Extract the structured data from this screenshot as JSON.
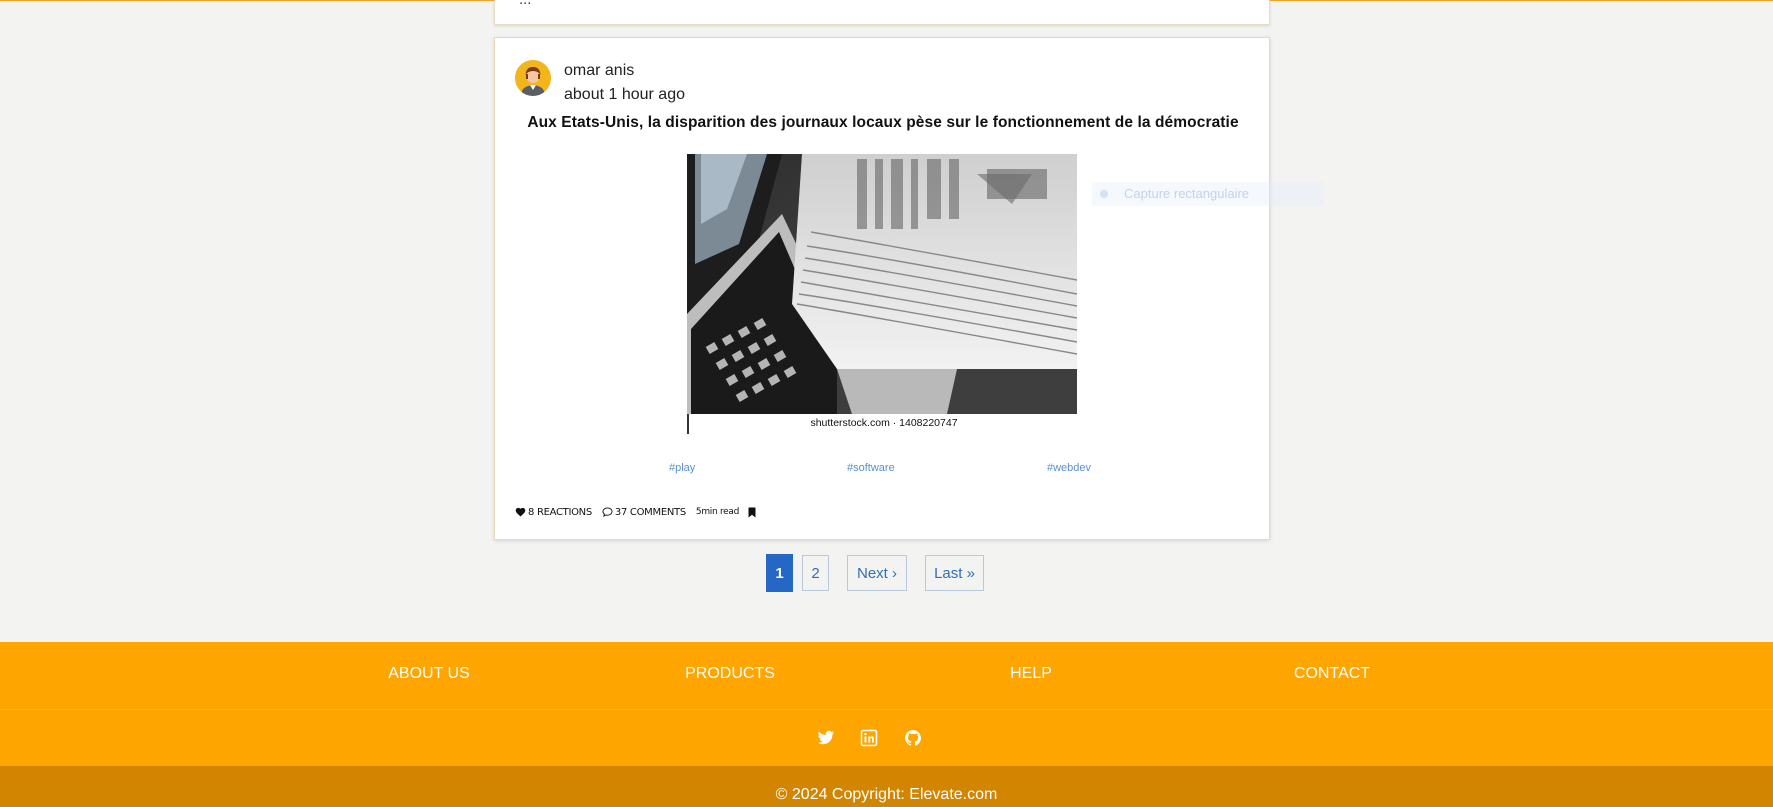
{
  "previous_post": {
    "cut_text": "..."
  },
  "post": {
    "author": "omar anis",
    "time": "about 1 hour ago",
    "title": "Aux Etats-Unis, la disparition des journaux locaux pèse sur le fonctionnement de la démocratie",
    "image_caption": "shutterstock.com · 1408220747",
    "tags": [
      "#play",
      "#software",
      "#webdev"
    ],
    "reactions": "8 REACTIONS",
    "comments": "37 COMMENTS",
    "read_time": "5min read"
  },
  "pagination": {
    "current": "1",
    "page2": "2",
    "next": "Next ›",
    "last": "Last »"
  },
  "footer": {
    "links": [
      "ABOUT US",
      "PRODUCTS",
      "HELP",
      "CONTACT"
    ],
    "copyright": "© 2024 Copyright: Elevate.com"
  },
  "overlay": {
    "tooltip_text": "Capture rectangulaire"
  },
  "colors": {
    "accent": "#ffa500",
    "footer_dark": "#d18500",
    "link": "#2f6fb7",
    "tag": "#5a8fd6"
  }
}
